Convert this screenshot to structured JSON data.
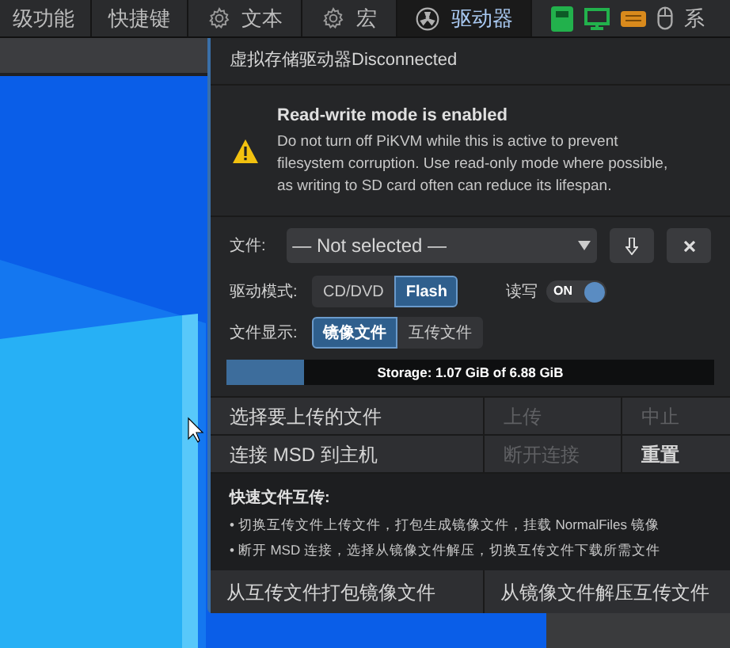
{
  "nav": {
    "tabs": [
      {
        "label": "级功能",
        "selected": false
      },
      {
        "label": "快捷键",
        "selected": false
      },
      {
        "label": "文本",
        "selected": false
      },
      {
        "label": "宏",
        "selected": false
      },
      {
        "label": "驱动器",
        "selected": true
      }
    ],
    "system_label": "系"
  },
  "panel": {
    "title": "虚拟存储驱动器Disconnected",
    "warning": {
      "title": "Read-write mode is enabled",
      "body": "Do not turn off PiKVM while this is active to prevent filesystem corruption. Use read-only mode where possible, as writing to SD card often can reduce its lifespan."
    },
    "file": {
      "label": "文件:",
      "value": "— Not selected —"
    },
    "drive_mode": {
      "label": "驱动模式:",
      "options": [
        {
          "label": "CD/DVD",
          "selected": false
        },
        {
          "label": "Flash",
          "selected": true
        }
      ]
    },
    "read_write": {
      "label": "读写",
      "on": true,
      "state_text": "ON"
    },
    "file_display": {
      "label": "文件显示:",
      "options": [
        {
          "label": "镜像文件",
          "selected": true
        },
        {
          "label": "互传文件",
          "selected": false
        }
      ]
    },
    "storage": {
      "level": 0.16,
      "text": "Storage: 1.07 GiB of 6.88 GiB"
    },
    "actions": [
      [
        {
          "label": "选择要上传的文件",
          "disabled": false
        },
        {
          "label": "上传",
          "disabled": true
        },
        {
          "label": "中止",
          "disabled": true
        }
      ],
      [
        {
          "label": "连接 MSD 到主机",
          "disabled": false
        },
        {
          "label": "断开连接",
          "disabled": true
        },
        {
          "label": "重置",
          "disabled": false
        }
      ]
    ],
    "quick_transfer": {
      "title": "快速文件互传:",
      "items": [
        "• 切换互传文件上传文件，打包生成镜像文件，挂载 NormalFiles 镜像",
        "• 断开 MSD 连接，选择从镜像文件解压，切换互传文件下载所需文件"
      ]
    },
    "bottom_buttons": [
      "从互传文件打包镜像文件",
      "从镜像文件解压互传文件"
    ]
  }
}
